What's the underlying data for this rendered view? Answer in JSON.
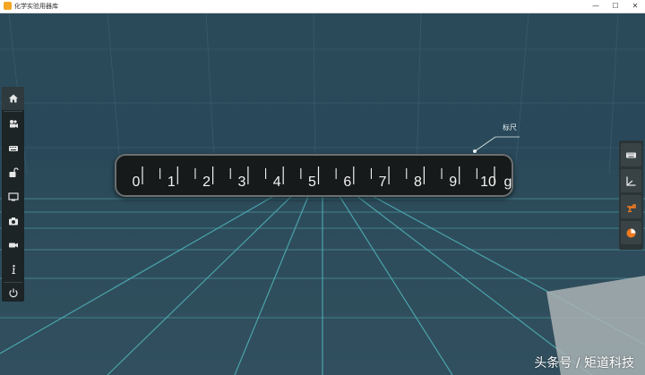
{
  "window": {
    "title": "化学实验用器库",
    "minimize_glyph": "—",
    "maximize_glyph": "☐",
    "close_glyph": "✕",
    "app_icon": "app-icon"
  },
  "left_toolbar": {
    "items": [
      {
        "name": "home",
        "icon": "home-icon"
      },
      {
        "name": "camera-view",
        "icon": "film-camera-icon"
      },
      {
        "name": "keyboard",
        "icon": "keyboard-icon"
      },
      {
        "name": "unlock",
        "icon": "unlock-icon"
      },
      {
        "name": "monitor",
        "icon": "monitor-icon"
      },
      {
        "name": "screenshot",
        "icon": "camera-icon"
      },
      {
        "name": "video",
        "icon": "video-camera-icon"
      },
      {
        "name": "info",
        "icon": "info-icon"
      },
      {
        "name": "power",
        "icon": "power-icon"
      }
    ]
  },
  "right_toolbar": {
    "items": [
      {
        "name": "keyboard",
        "icon": "keyboard-icon"
      },
      {
        "name": "axes",
        "icon": "axes-icon"
      },
      {
        "name": "faucet",
        "icon": "faucet-icon"
      },
      {
        "name": "pie-chart",
        "icon": "pie-chart-icon"
      }
    ]
  },
  "ruler": {
    "labels": [
      "0",
      "1",
      "2",
      "3",
      "4",
      "5",
      "6",
      "7",
      "8",
      "9",
      "10"
    ],
    "unit": "g"
  },
  "callout": {
    "label": "标尺"
  },
  "watermark": "头条号 / 矩道科技",
  "colors": {
    "accent_orange": "#f07a20",
    "scene_bg": "#2a4a59",
    "grid_line": "#4fb2b8"
  }
}
